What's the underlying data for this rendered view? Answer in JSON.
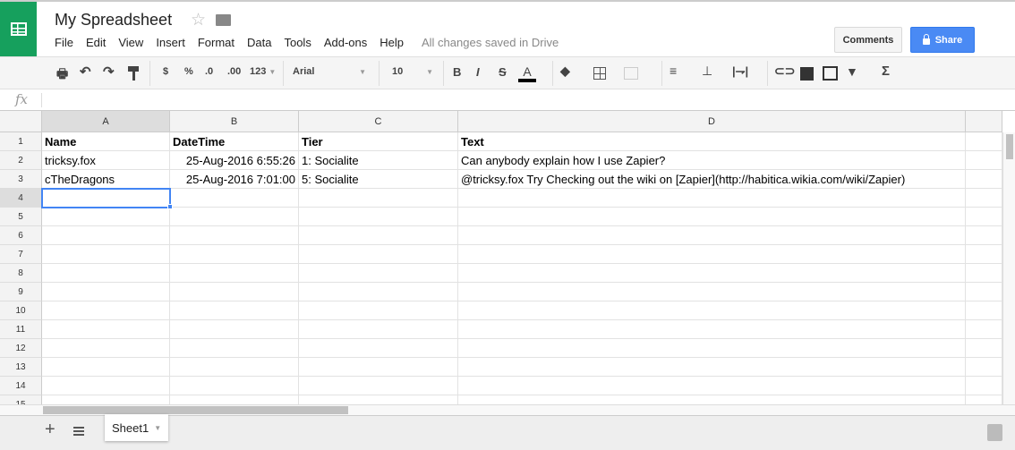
{
  "app": {
    "title": "My Spreadsheet",
    "status": "All changes saved in Drive",
    "comments_label": "Comments",
    "share_label": "Share"
  },
  "menu": [
    "File",
    "Edit",
    "View",
    "Insert",
    "Format",
    "Data",
    "Tools",
    "Add-ons",
    "Help"
  ],
  "toolbar": {
    "currency": "$",
    "percent": "%",
    "dec_less": ".0",
    "dec_more": ".00",
    "format_more": "123",
    "font": "Arial",
    "size": "10",
    "bold": "B",
    "italic": "I",
    "strike": "S",
    "text_color": "A",
    "sum": "Σ"
  },
  "formula": {
    "label": "fx",
    "value": ""
  },
  "columns": [
    "A",
    "B",
    "C",
    "D"
  ],
  "rows": [
    [
      "Name",
      "DateTime",
      "Tier",
      "Text"
    ],
    [
      "tricksy.fox",
      "25-Aug-2016 6:55:26",
      "1: Socialite",
      "Can anybody explain how I use Zapier?"
    ],
    [
      "cTheDragons",
      "25-Aug-2016 7:01:00",
      "5: Socialite",
      "@tricksy.fox Try Checking out the wiki on [Zapier](http://habitica.wikia.com/wiki/Zapier)"
    ]
  ],
  "row_numbers": [
    "1",
    "2",
    "3",
    "4",
    "5",
    "6",
    "7",
    "8",
    "9",
    "10",
    "11",
    "12",
    "13",
    "14",
    "15"
  ],
  "selected_cell": "A4",
  "sheets": [
    {
      "name": "Sheet1",
      "active": true
    }
  ],
  "colors": {
    "brand": "#16a05d",
    "share": "#4a8af4",
    "selection": "#4285f4"
  }
}
